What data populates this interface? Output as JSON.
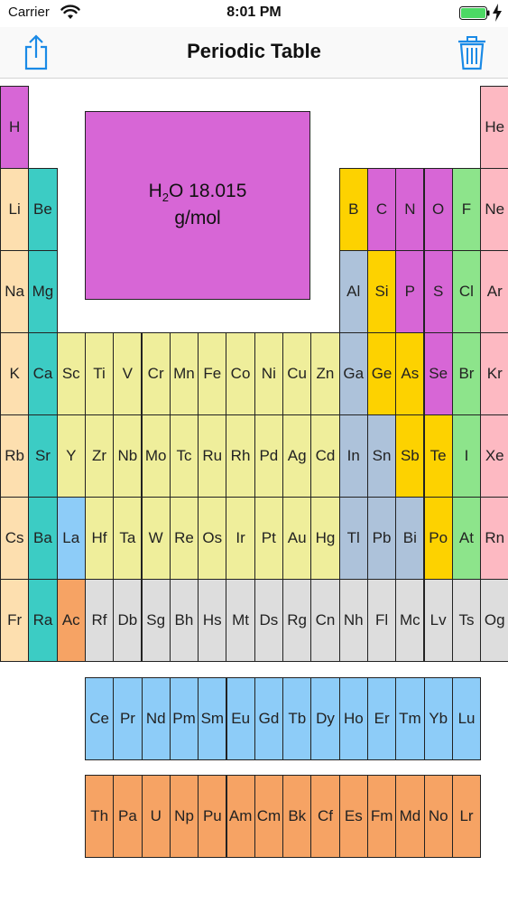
{
  "status_bar": {
    "carrier": "Carrier",
    "time": "8:01 PM"
  },
  "nav": {
    "title": "Periodic Table",
    "share_icon": "share-icon",
    "trash_icon": "trash-icon"
  },
  "selected": {
    "formula_main": "H",
    "formula_sub": "2",
    "formula_rest": "O",
    "mass": "18.015",
    "unit": "g/mol"
  },
  "colors": {
    "alkali": "#fddfaf",
    "alkaline": "#3cccc4",
    "transition": "#efee9b",
    "lanthanide": "#8dccf8",
    "actinide": "#f6a364",
    "metalloid": "#fdd200",
    "nonmetal": "#d766d6",
    "halogen": "#8de48b",
    "noble": "#fdb9c2",
    "post": "#adc2da",
    "unknown": "#dddddd"
  },
  "rows": [
    [
      [
        "H",
        "nonmetal"
      ],
      null,
      null,
      null,
      null,
      null,
      null,
      null,
      null,
      null,
      null,
      null,
      null,
      null,
      null,
      null,
      null,
      [
        "He",
        "noble"
      ]
    ],
    [
      [
        "Li",
        "alkali"
      ],
      [
        "Be",
        "alkaline"
      ],
      null,
      null,
      null,
      null,
      null,
      null,
      null,
      null,
      null,
      null,
      [
        "B",
        "metalloid"
      ],
      [
        "C",
        "nonmetal"
      ],
      [
        "N",
        "nonmetal"
      ],
      [
        "O",
        "nonmetal"
      ],
      [
        "F",
        "halogen"
      ],
      [
        "Ne",
        "noble"
      ]
    ],
    [
      [
        "Na",
        "alkali"
      ],
      [
        "Mg",
        "alkaline"
      ],
      null,
      null,
      null,
      null,
      null,
      null,
      null,
      null,
      null,
      null,
      [
        "Al",
        "post"
      ],
      [
        "Si",
        "metalloid"
      ],
      [
        "P",
        "nonmetal"
      ],
      [
        "S",
        "nonmetal"
      ],
      [
        "Cl",
        "halogen"
      ],
      [
        "Ar",
        "noble"
      ]
    ],
    [
      [
        "K",
        "alkali"
      ],
      [
        "Ca",
        "alkaline"
      ],
      [
        "Sc",
        "transition"
      ],
      [
        "Ti",
        "transition"
      ],
      [
        "V",
        "transition"
      ],
      [
        "Cr",
        "transition"
      ],
      [
        "Mn",
        "transition"
      ],
      [
        "Fe",
        "transition"
      ],
      [
        "Co",
        "transition"
      ],
      [
        "Ni",
        "transition"
      ],
      [
        "Cu",
        "transition"
      ],
      [
        "Zn",
        "transition"
      ],
      [
        "Ga",
        "post"
      ],
      [
        "Ge",
        "metalloid"
      ],
      [
        "As",
        "metalloid"
      ],
      [
        "Se",
        "nonmetal"
      ],
      [
        "Br",
        "halogen"
      ],
      [
        "Kr",
        "noble"
      ]
    ],
    [
      [
        "Rb",
        "alkali"
      ],
      [
        "Sr",
        "alkaline"
      ],
      [
        "Y",
        "transition"
      ],
      [
        "Zr",
        "transition"
      ],
      [
        "Nb",
        "transition"
      ],
      [
        "Mo",
        "transition"
      ],
      [
        "Tc",
        "transition"
      ],
      [
        "Ru",
        "transition"
      ],
      [
        "Rh",
        "transition"
      ],
      [
        "Pd",
        "transition"
      ],
      [
        "Ag",
        "transition"
      ],
      [
        "Cd",
        "transition"
      ],
      [
        "In",
        "post"
      ],
      [
        "Sn",
        "post"
      ],
      [
        "Sb",
        "metalloid"
      ],
      [
        "Te",
        "metalloid"
      ],
      [
        "I",
        "halogen"
      ],
      [
        "Xe",
        "noble"
      ]
    ],
    [
      [
        "Cs",
        "alkali"
      ],
      [
        "Ba",
        "alkaline"
      ],
      [
        "La",
        "lanthanide"
      ],
      [
        "Hf",
        "transition"
      ],
      [
        "Ta",
        "transition"
      ],
      [
        "W",
        "transition"
      ],
      [
        "Re",
        "transition"
      ],
      [
        "Os",
        "transition"
      ],
      [
        "Ir",
        "transition"
      ],
      [
        "Pt",
        "transition"
      ],
      [
        "Au",
        "transition"
      ],
      [
        "Hg",
        "transition"
      ],
      [
        "Tl",
        "post"
      ],
      [
        "Pb",
        "post"
      ],
      [
        "Bi",
        "post"
      ],
      [
        "Po",
        "metalloid"
      ],
      [
        "At",
        "halogen"
      ],
      [
        "Rn",
        "noble"
      ]
    ],
    [
      [
        "Fr",
        "alkali"
      ],
      [
        "Ra",
        "alkaline"
      ],
      [
        "Ac",
        "actinide"
      ],
      [
        "Rf",
        "unknown"
      ],
      [
        "Db",
        "unknown"
      ],
      [
        "Sg",
        "unknown"
      ],
      [
        "Bh",
        "unknown"
      ],
      [
        "Hs",
        "unknown"
      ],
      [
        "Mt",
        "unknown"
      ],
      [
        "Ds",
        "unknown"
      ],
      [
        "Rg",
        "unknown"
      ],
      [
        "Cn",
        "unknown"
      ],
      [
        "Nh",
        "unknown"
      ],
      [
        "Fl",
        "unknown"
      ],
      [
        "Mc",
        "unknown"
      ],
      [
        "Lv",
        "unknown"
      ],
      [
        "Ts",
        "unknown"
      ],
      [
        "Og",
        "unknown"
      ]
    ]
  ],
  "lanthanides": [
    "Ce",
    "Pr",
    "Nd",
    "Pm",
    "Sm",
    "Eu",
    "Gd",
    "Tb",
    "Dy",
    "Ho",
    "Er",
    "Tm",
    "Yb",
    "Lu"
  ],
  "actinides": [
    "Th",
    "Pa",
    "U",
    "Np",
    "Pu",
    "Am",
    "Cm",
    "Bk",
    "Cf",
    "Es",
    "Fm",
    "Md",
    "No",
    "Lr"
  ]
}
